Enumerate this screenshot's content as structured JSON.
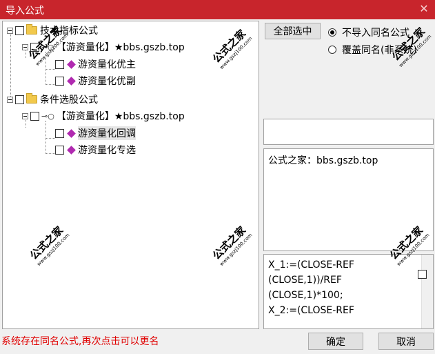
{
  "window": {
    "title": "导入公式",
    "close_glyph": "✕"
  },
  "tree": {
    "items": [
      {
        "label": "技术指标公式",
        "kind": "folder"
      },
      {
        "label": "【游资量化】★bbs.gszb.top",
        "kind": "key"
      },
      {
        "label": "游资量化优主",
        "kind": "formula"
      },
      {
        "label": "游资量化优副",
        "kind": "formula"
      },
      {
        "label": "条件选股公式",
        "kind": "folder"
      },
      {
        "label": "【游资量化】★bbs.gszb.top",
        "kind": "key"
      },
      {
        "label": "游资量化回调",
        "kind": "formula",
        "selected": true
      },
      {
        "label": "游资量化专选",
        "kind": "formula"
      }
    ]
  },
  "toolbar": {
    "select_all_label": "全部选中"
  },
  "options": {
    "no_import_same": {
      "label": "不导入同名公式",
      "checked": true
    },
    "overwrite_same": {
      "label": "覆盖同名(非系统)",
      "checked": false
    }
  },
  "description": "公式之家：bbs.gszb.top",
  "code_lines": [
    "X_1:=(CLOSE-REF",
    "(CLOSE,1))/REF",
    "(CLOSE,1)*100;",
    "X_2:=(CLOSE-REF"
  ],
  "status": "系统存在同名公式,再次点击可以更名",
  "buttons": {
    "ok": "确定",
    "cancel": "取消"
  },
  "watermark": {
    "text": "公式之家",
    "url": "www.gszj100.com"
  }
}
